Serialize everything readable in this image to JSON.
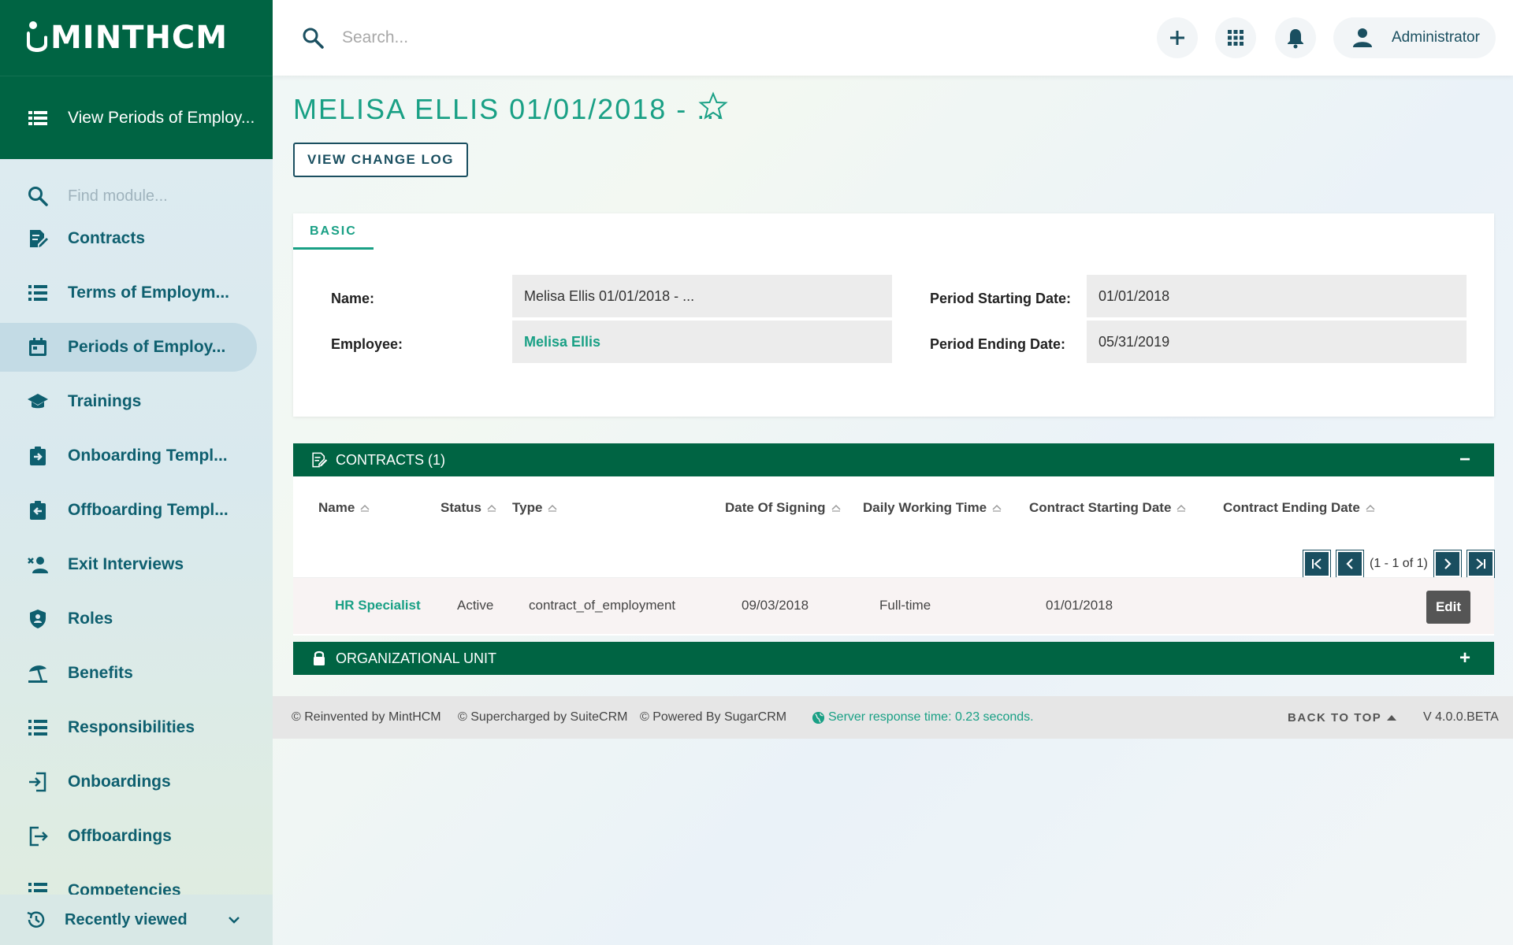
{
  "brand": {
    "name": "MINTHCM"
  },
  "sidebar": {
    "view_label": "View Periods of Employ...",
    "find_placeholder": "Find module...",
    "items": [
      {
        "label": "Contracts",
        "icon": "contract-icon"
      },
      {
        "label": "Terms of Employm...",
        "icon": "list-icon"
      },
      {
        "label": "Periods of Employ...",
        "icon": "calendar-icon",
        "active": true
      },
      {
        "label": "Trainings",
        "icon": "graduation-cap-icon"
      },
      {
        "label": "Onboarding Templ...",
        "icon": "clipboard-in-icon"
      },
      {
        "label": "Offboarding Templ...",
        "icon": "clipboard-out-icon"
      },
      {
        "label": "Exit Interviews",
        "icon": "user-remove-icon"
      },
      {
        "label": "Roles",
        "icon": "shield-user-icon"
      },
      {
        "label": "Benefits",
        "icon": "beach-umbrella-icon"
      },
      {
        "label": "Responsibilities",
        "icon": "list-icon"
      },
      {
        "label": "Onboardings",
        "icon": "login-icon"
      },
      {
        "label": "Offboardings",
        "icon": "logout-icon"
      },
      {
        "label": "Competencies",
        "icon": "list-icon"
      }
    ],
    "recently_viewed": "Recently viewed"
  },
  "topbar": {
    "search_placeholder": "Search...",
    "user_name": "Administrator"
  },
  "record": {
    "title": "MELISA ELLIS 01/01/2018 - ...",
    "change_log_label": "VIEW CHANGE LOG",
    "tab_label": "BASIC",
    "fields": {
      "name_label": "Name:",
      "name_value": "Melisa Ellis 01/01/2018 - ...",
      "employee_label": "Employee:",
      "employee_value": "Melisa Ellis",
      "start_label": "Period Starting Date:",
      "start_value": "01/01/2018",
      "end_label": "Period Ending Date:",
      "end_value": "05/31/2019"
    }
  },
  "contracts": {
    "header": "CONTRACTS (1)",
    "toggle": "−",
    "columns": [
      "Name",
      "Status",
      "Type",
      "Date Of Signing",
      "Daily Working Time",
      "Contract Starting Date",
      "Contract Ending Date"
    ],
    "pager_text": "(1 - 1 of 1)",
    "rows": [
      {
        "name": "HR Specialist",
        "status": "Active",
        "type": "contract_of_employment",
        "date_signing": "09/03/2018",
        "working_time": "Full-time",
        "start": "01/01/2018",
        "end": ""
      }
    ],
    "edit_label": "Edit"
  },
  "org_unit": {
    "header": "ORGANIZATIONAL UNIT",
    "toggle": "+"
  },
  "footer": {
    "reinvented": "© Reinvented by MintHCM",
    "supercharged": "© Supercharged by SuiteCRM",
    "powered": "© Powered By SugarCRM",
    "server": "Server response time: 0.23 seconds.",
    "back_to_top": "BACK TO TOP",
    "version": "V 4.0.0.BETA"
  },
  "colors": {
    "brand_green": "#006443",
    "accent": "#19a085",
    "nav_text": "#0e5f6f"
  }
}
